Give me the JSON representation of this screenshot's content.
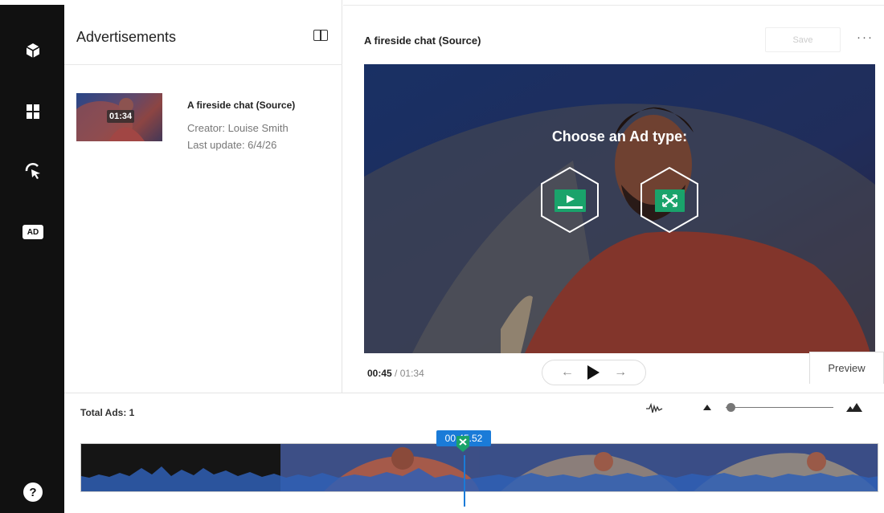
{
  "rail": {
    "items": [
      {
        "name": "cube-icon"
      },
      {
        "name": "film-icon"
      },
      {
        "name": "cursor-icon"
      },
      {
        "name": "ad-icon",
        "label": "AD"
      }
    ],
    "help_label": "?"
  },
  "left_panel": {
    "title": "Advertisements",
    "video": {
      "title": "A fireside chat (Source)",
      "duration": "01:34",
      "creator": "Creator: Louise Smith",
      "last_update": "Last update: 6/4/26"
    }
  },
  "editor": {
    "title": "A fireside chat (Source)",
    "save_label": "Save",
    "more_label": "···",
    "overlay_heading": "Choose an Ad type:",
    "ad_types": [
      {
        "name": "video-ad-icon"
      },
      {
        "name": "overlay-ad-icon"
      }
    ],
    "time_current": "00:45",
    "time_separator": "/",
    "time_total": "01:34",
    "preview_label": "Preview"
  },
  "timeline": {
    "total_ads_label": "Total Ads: 1",
    "playhead_time": "00:45.52",
    "zoom_level": 0.05
  },
  "colors": {
    "rail": "#111111",
    "accent": "#1a7bd8",
    "ad_green": "#1aa36b"
  }
}
